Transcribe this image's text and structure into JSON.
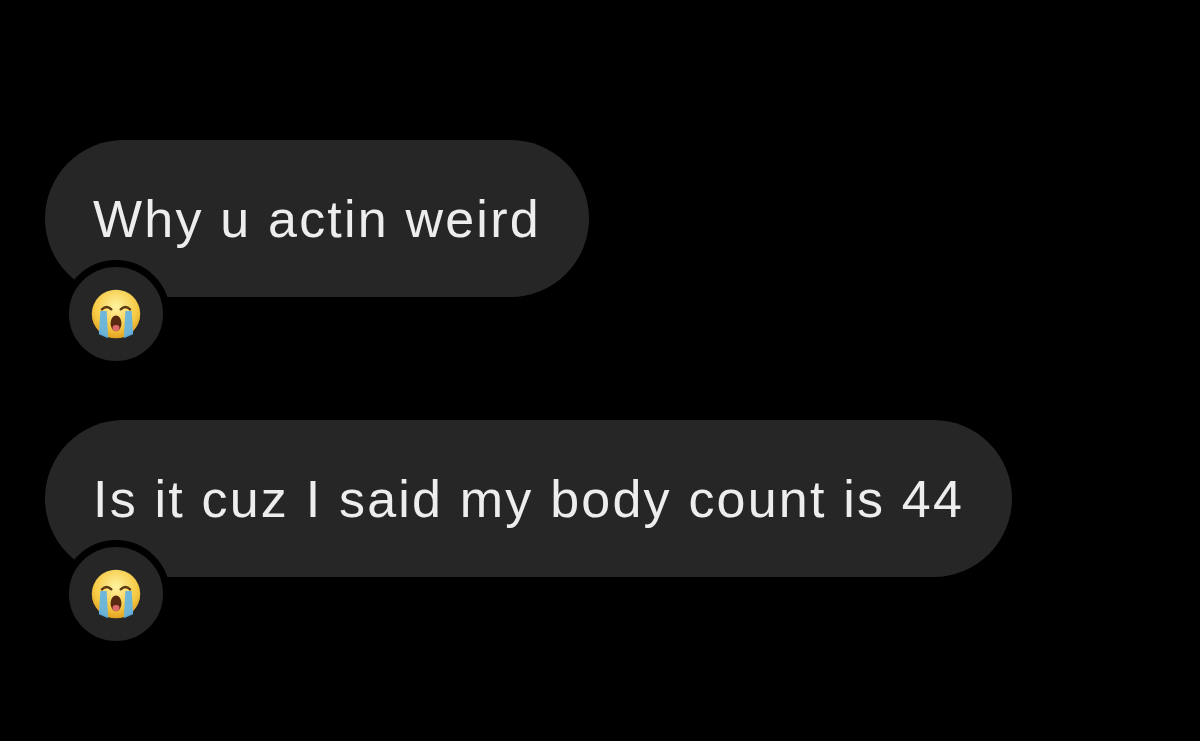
{
  "messages": [
    {
      "text": "Why u actin weird",
      "reaction": true
    },
    {
      "text": "Is it cuz I said my body count is 44",
      "reaction": true
    }
  ]
}
